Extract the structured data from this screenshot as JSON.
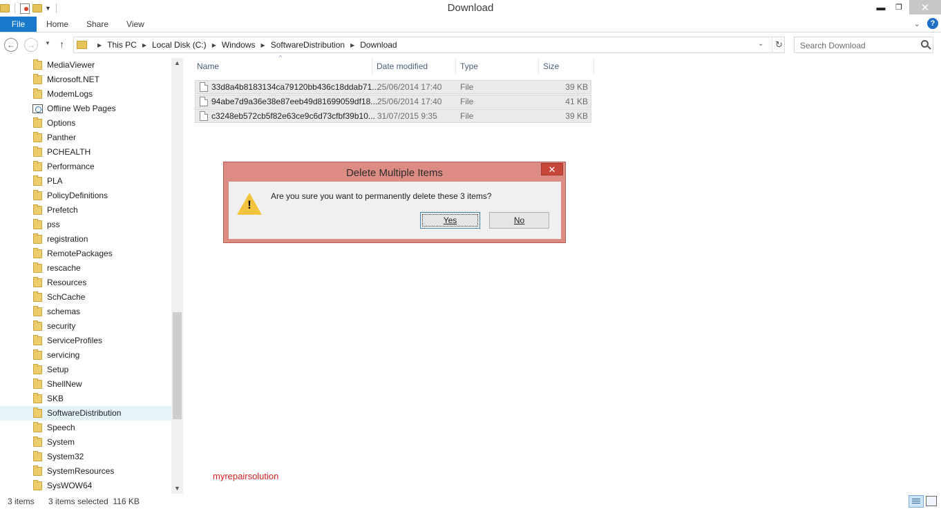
{
  "window": {
    "title": "Download"
  },
  "ribbon": {
    "tabs": [
      "File",
      "Home",
      "Share",
      "View"
    ]
  },
  "address": {
    "crumbs": [
      "This PC",
      "Local Disk (C:)",
      "Windows",
      "SoftwareDistribution",
      "Download"
    ],
    "search_placeholder": "Search Download"
  },
  "nav_tree": [
    {
      "label": "MediaViewer",
      "icon": "folder-icon"
    },
    {
      "label": "Microsoft.NET",
      "icon": "folder-icon"
    },
    {
      "label": "ModemLogs",
      "icon": "folder-icon"
    },
    {
      "label": "Offline Web Pages",
      "icon": "web-pages-icon"
    },
    {
      "label": "Options",
      "icon": "folder-icon"
    },
    {
      "label": "Panther",
      "icon": "folder-icon"
    },
    {
      "label": "PCHEALTH",
      "icon": "folder-icon"
    },
    {
      "label": "Performance",
      "icon": "folder-icon"
    },
    {
      "label": "PLA",
      "icon": "folder-icon"
    },
    {
      "label": "PolicyDefinitions",
      "icon": "folder-icon"
    },
    {
      "label": "Prefetch",
      "icon": "folder-icon"
    },
    {
      "label": "pss",
      "icon": "folder-icon"
    },
    {
      "label": "registration",
      "icon": "folder-icon"
    },
    {
      "label": "RemotePackages",
      "icon": "folder-icon"
    },
    {
      "label": "rescache",
      "icon": "folder-icon"
    },
    {
      "label": "Resources",
      "icon": "folder-icon"
    },
    {
      "label": "SchCache",
      "icon": "folder-icon"
    },
    {
      "label": "schemas",
      "icon": "folder-icon"
    },
    {
      "label": "security",
      "icon": "folder-icon"
    },
    {
      "label": "ServiceProfiles",
      "icon": "folder-icon"
    },
    {
      "label": "servicing",
      "icon": "folder-icon"
    },
    {
      "label": "Setup",
      "icon": "folder-icon"
    },
    {
      "label": "ShellNew",
      "icon": "folder-icon"
    },
    {
      "label": "SKB",
      "icon": "folder-icon"
    },
    {
      "label": "SoftwareDistribution",
      "icon": "folder-icon",
      "selected": true
    },
    {
      "label": "Speech",
      "icon": "folder-icon"
    },
    {
      "label": "System",
      "icon": "folder-icon"
    },
    {
      "label": "System32",
      "icon": "folder-icon"
    },
    {
      "label": "SystemResources",
      "icon": "folder-icon"
    },
    {
      "label": "SysWOW64",
      "icon": "folder-icon"
    }
  ],
  "file_list": {
    "columns": [
      "Name",
      "Date modified",
      "Type",
      "Size"
    ],
    "rows": [
      {
        "name": "33d8a4b8183134ca79120bb436c18ddab71...",
        "date": "25/06/2014 17:40",
        "type": "File",
        "size": "39 KB"
      },
      {
        "name": "94abe7d9a36e38e87eeb49d81699059df18...",
        "date": "25/06/2014 17:40",
        "type": "File",
        "size": "41 KB"
      },
      {
        "name": "c3248eb572cb5f82e63ce9c6d73cfbf39b10...",
        "date": "31/07/2015 9:35",
        "type": "File",
        "size": "39 KB"
      }
    ]
  },
  "dialog": {
    "title": "Delete Multiple Items",
    "message": "Are you sure you want to permanently delete these 3 items?",
    "yes_label": "Yes",
    "no_label": "No",
    "close_glyph": "✕",
    "accent_color": "#dc8c82"
  },
  "watermark": "myrepairsolution",
  "status": {
    "item_count": "3 items",
    "selection": "3 items selected  116 KB"
  }
}
